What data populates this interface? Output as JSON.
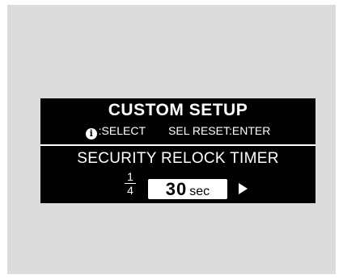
{
  "header": {
    "title": "CUSTOM SETUP",
    "select_hint": ":SELECT",
    "reset_hint": "SEL RESET:ENTER",
    "info_glyph": "i"
  },
  "item": {
    "title": "SECURITY RELOCK TIMER",
    "page_current": "1",
    "page_total": "4",
    "value": "30",
    "unit": "sec"
  },
  "icons": {
    "info": "info-circle-icon",
    "next": "right-arrow-icon"
  },
  "colors": {
    "screen_bg": "#000000",
    "text": "#ffffff",
    "frame_bg": "#dcdcdc"
  }
}
